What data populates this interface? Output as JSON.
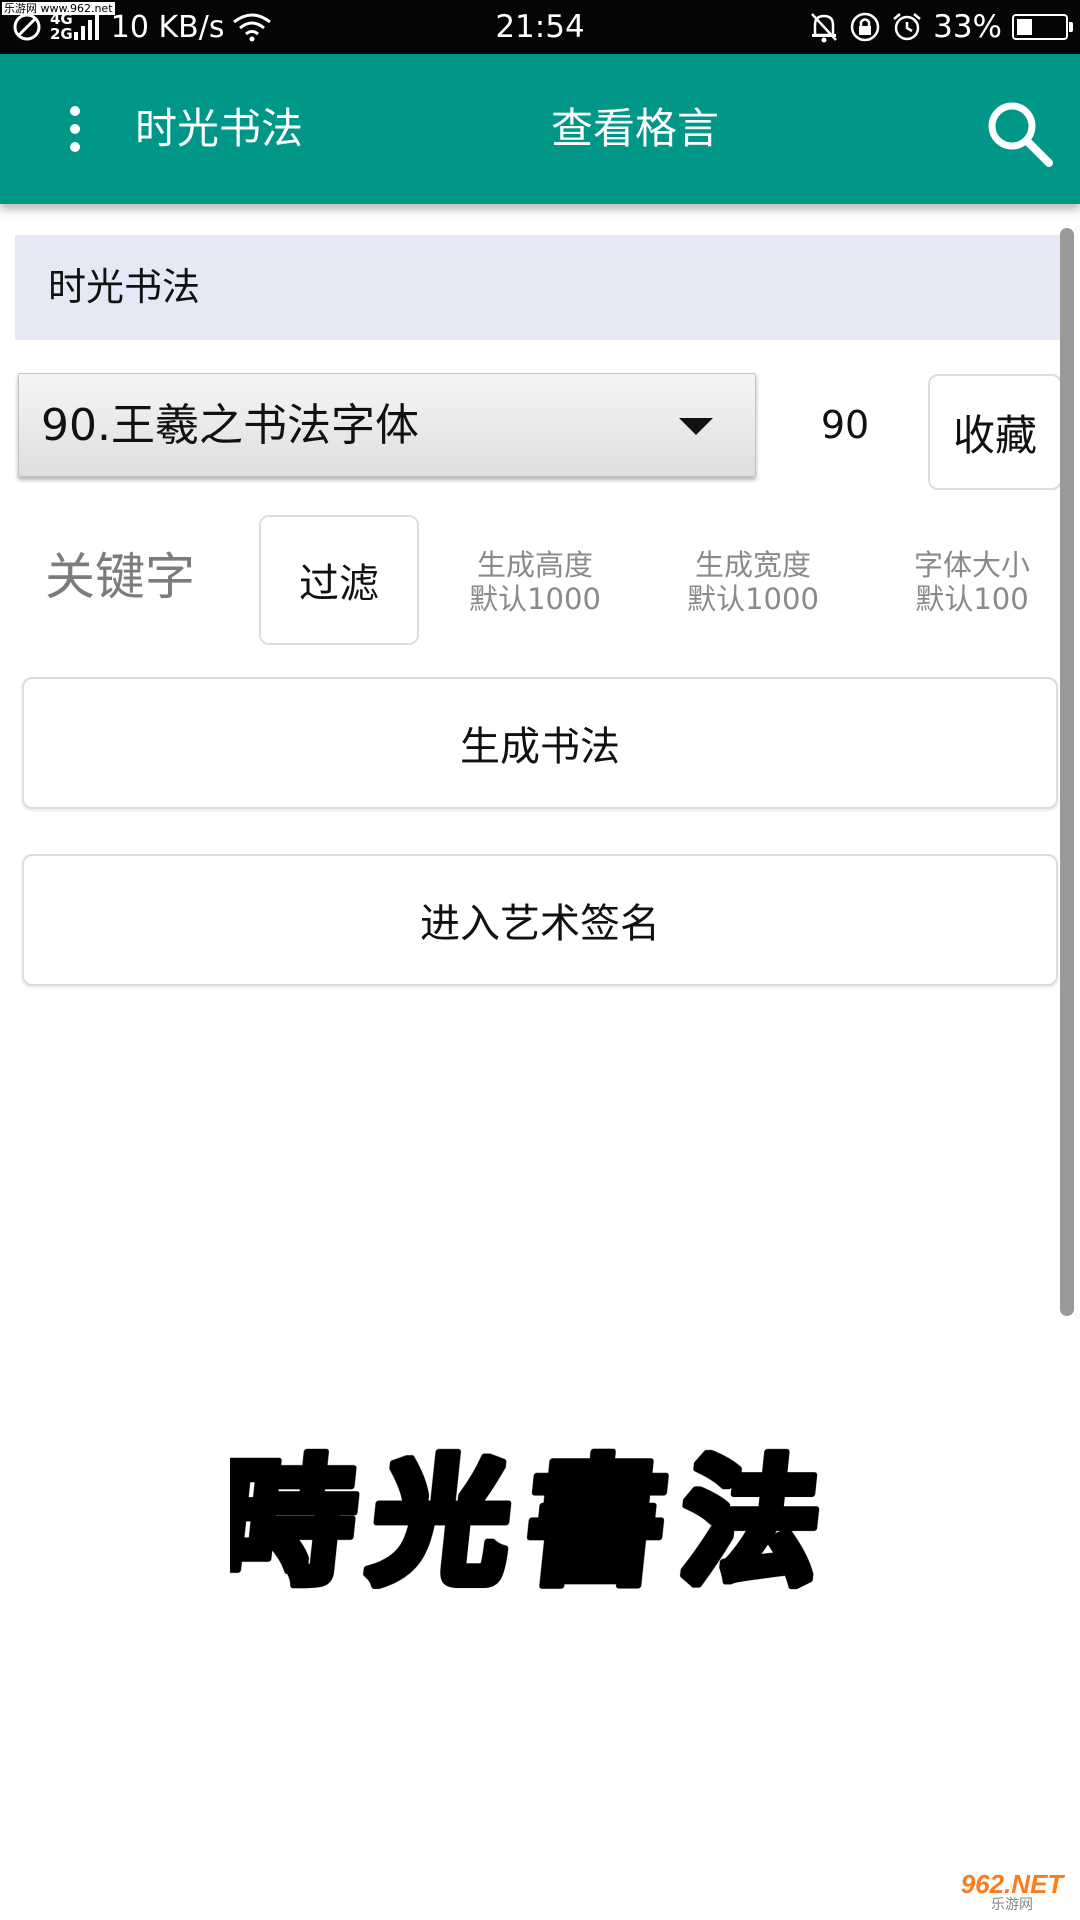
{
  "status_bar": {
    "net_type_top": "4G",
    "net_type_bottom": "2G",
    "speed": "10 KB/s",
    "time": "21:54",
    "battery_percent_text": "33%",
    "battery_level": 0.33,
    "icons": [
      "no-sim-icon",
      "signal-icon",
      "wifi-icon",
      "mute-icon",
      "rotation-lock-icon",
      "alarm-icon",
      "battery-icon"
    ]
  },
  "watermarks": {
    "top_left": "乐游网 www.962.net",
    "bottom_right_main": "962.NET",
    "bottom_right_sub": "乐游网"
  },
  "app_bar": {
    "title": "时光书法",
    "center_action": "查看格言",
    "accent_color": "#009688"
  },
  "section_header": "时光书法",
  "font_selector": {
    "selected": "90.王羲之书法字体"
  },
  "count_value": "90",
  "favorite_button": "收藏",
  "keyword_label": "关键字",
  "filter_button": "过滤",
  "params": [
    {
      "label": "生成高度",
      "default": "默认1000"
    },
    {
      "label": "生成宽度",
      "default": "默认1000"
    },
    {
      "label": "字体大小",
      "default": "默认100"
    }
  ],
  "generate_button": "生成书法",
  "signature_button": "进入艺术签名",
  "preview_text": "時光書法"
}
